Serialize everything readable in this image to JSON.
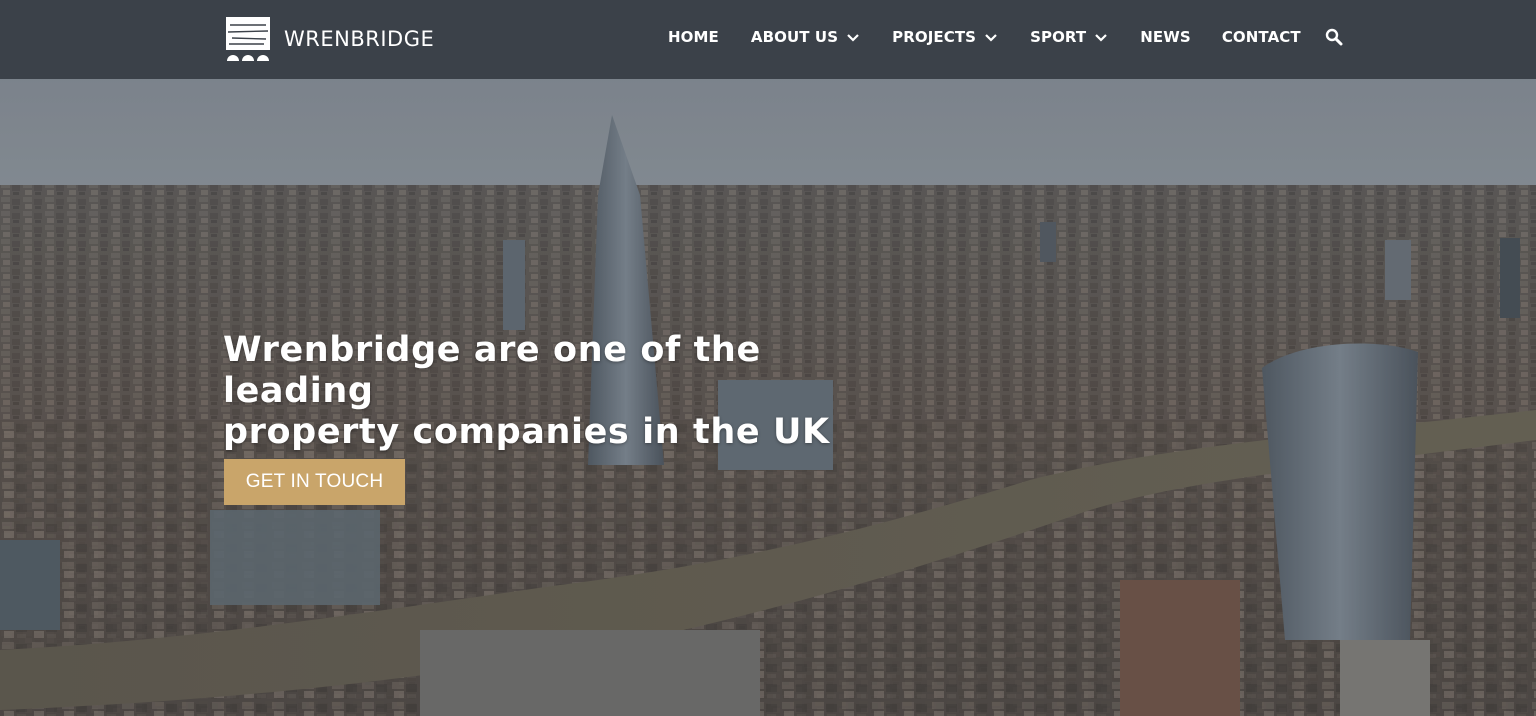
{
  "brand": {
    "name": "WRENBRIDGE",
    "logo_icon": "wrenbridge-logo-icon"
  },
  "nav": {
    "items": [
      {
        "label": "HOME",
        "has_dropdown": false
      },
      {
        "label": "ABOUT US",
        "has_dropdown": true
      },
      {
        "label": "PROJECTS",
        "has_dropdown": true
      },
      {
        "label": "SPORT",
        "has_dropdown": true
      },
      {
        "label": "NEWS",
        "has_dropdown": false
      },
      {
        "label": "CONTACT",
        "has_dropdown": false
      }
    ],
    "search_icon": "search-icon",
    "dropdown_icon": "chevron-down-icon"
  },
  "hero": {
    "headline_line1": "Wrenbridge are one of the leading",
    "headline_line2": "property companies in the UK",
    "cta_label": "GET IN TOUCH",
    "background": "aerial-city-photo"
  },
  "colors": {
    "header_bg": "#3b4149",
    "cta_bg": "#c9a56a",
    "text": "#ffffff"
  }
}
